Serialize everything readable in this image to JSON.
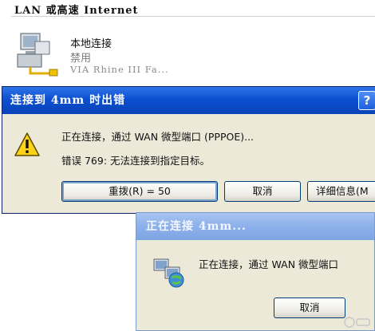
{
  "background": {
    "header": "LAN 或高速 Internet",
    "connection": {
      "name": "本地连接",
      "status": "禁用",
      "device": "VIA Rhine III Fa..."
    }
  },
  "error_dialog": {
    "title": "连接到 4mm 时出错",
    "help_label": "?",
    "message_line1": "正在连接，通过 WAN 微型端口 (PPPOE)...",
    "message_line2": "错误 769: 无法连接到指定目标。",
    "buttons": {
      "redial": "重拨(R) = 50",
      "cancel": "取消",
      "details": "详细信息(M"
    }
  },
  "connecting_dialog": {
    "title": "正在连接 4mm...",
    "message": "正在连接，通过 WAN 微型端口",
    "cancel": "取消"
  },
  "colors": {
    "active_title": "#0d4fcf",
    "inactive_title": "#8cb0ea",
    "dialog_face": "#ece9d8"
  }
}
